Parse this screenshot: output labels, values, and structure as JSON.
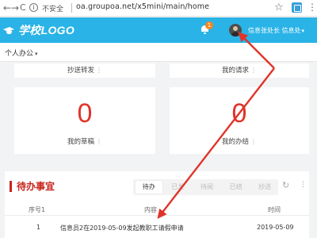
{
  "browser": {
    "back": "←",
    "forward": "→",
    "reload": "C",
    "lock_symbol": "i",
    "security_label": "不安全",
    "url": "oa.groupoa.net/x5mini/main/home",
    "star": "☆",
    "menu": "⋮"
  },
  "header": {
    "logo_text": "学校LOGO",
    "notification_count": "1",
    "user_name": "信息张处长  信息处",
    "user_caret": "▾"
  },
  "subnav": {
    "label": "个人办公",
    "caret": "▾"
  },
  "cards": [
    {
      "label": "抄送转发",
      "more": "⋮"
    },
    {
      "label": "我的请求",
      "more": "⋮"
    },
    {
      "number": "0",
      "label": "我的草稿",
      "more": "⋮"
    },
    {
      "number": "0",
      "label": "我的办结",
      "more": "⋮"
    }
  ],
  "todo": {
    "title": "待办事宜",
    "tabs": [
      "待办",
      "已发",
      "待阅",
      "已结",
      "抄送"
    ],
    "active_tab": "待办",
    "refresh_icon": "↻",
    "more_icon": "⋮",
    "columns": [
      "序号1",
      "内容",
      "时间"
    ],
    "rows": [
      {
        "index": "1",
        "content": "信息员2在2019-05-09发起教职工请假申请",
        "time": "2019-05-09"
      }
    ]
  },
  "colors": {
    "header_bg": "#2ab3e6",
    "accent_red": "#e0342a",
    "arrow": "#e0342a"
  }
}
